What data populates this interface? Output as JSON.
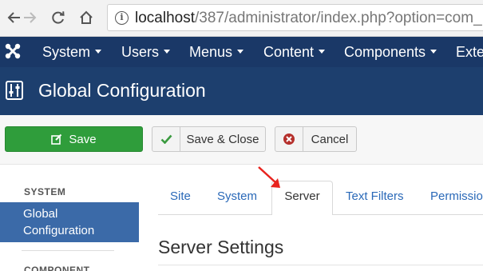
{
  "browser": {
    "url_host": "localhost",
    "url_path": "/387/administrator/index.php?option=com_",
    "info_glyph": "i"
  },
  "menu": {
    "items": [
      "System",
      "Users",
      "Menus",
      "Content",
      "Components",
      "Exte"
    ]
  },
  "header": {
    "title": "Global Configuration"
  },
  "toolbar": {
    "save": "Save",
    "save_close": "Save & Close",
    "cancel": "Cancel"
  },
  "sidebar": {
    "system_heading": "SYSTEM",
    "active_item_line1": "Global",
    "active_item_line2": "Configuration",
    "component_heading": "COMPONENT"
  },
  "tabs": {
    "items": [
      "Site",
      "System",
      "Server",
      "Text Filters",
      "Permissio"
    ],
    "active": "Server"
  },
  "main": {
    "section_title": "Server Settings"
  },
  "colors": {
    "menu_bg": "#1a3867",
    "header_bg": "#1d3f6e",
    "save_green": "#2f9d3b",
    "sidebar_active": "#3b6aa8",
    "tab_link": "#2a69b8",
    "annotation_red": "#e8231e"
  },
  "icons": [
    "back-arrow-icon",
    "forward-arrow-icon",
    "reload-icon",
    "home-icon",
    "info-icon",
    "joomla-logo-icon",
    "settings-sliders-icon",
    "edit-icon",
    "check-icon",
    "cancel-circle-icon",
    "red-arrow-annotation"
  ]
}
